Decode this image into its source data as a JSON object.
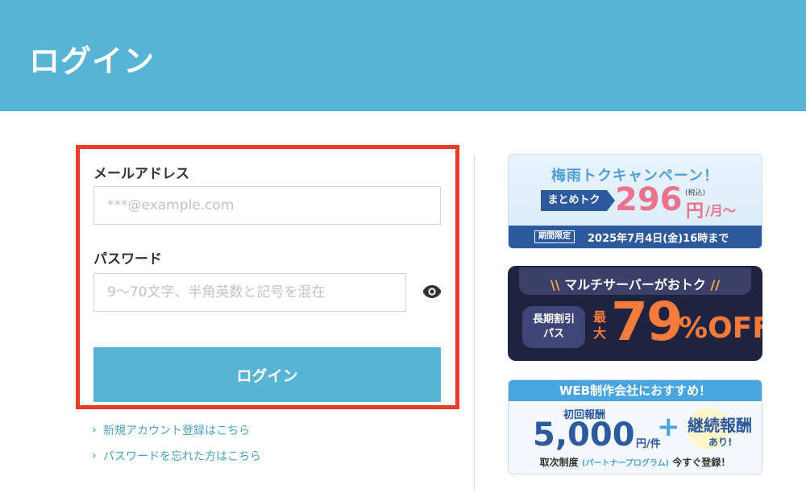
{
  "header": {
    "title": "ログイン"
  },
  "form": {
    "email_label": "メールアドレス",
    "email_placeholder": "***@example.com",
    "email_value": "",
    "password_label": "パスワード",
    "password_placeholder": "9〜70文字、半角英数と記号を混在",
    "password_value": "",
    "toggle_icon": "eye-icon",
    "submit_label": "ログイン"
  },
  "links": {
    "new_account": "新規アカウント登録はこちら",
    "forgot_password": "パスワードを忘れた方はこちら"
  },
  "banners": {
    "rainy": {
      "title": "梅雨トクキャンペーン！",
      "tag": "まとめトク",
      "price": "296",
      "yen": "円",
      "per": "/月〜",
      "tax": "(税込)",
      "limit": "期間限定",
      "date": "2025年7月4日(金)16時まで"
    },
    "multi": {
      "title": "マルチサーバーがおトク",
      "pill_line1": "長期割引",
      "pill_line2": "パス",
      "max": "最大",
      "num": "79",
      "off": "%OFF"
    },
    "web": {
      "head": "WEB制作会社におすすめ！",
      "sub": "初回報酬",
      "num": "5,000",
      "unit": "円/件",
      "plus": "+",
      "continuous": "継続報酬",
      "ari": "あり!",
      "foot_main": "取次制度",
      "foot_paren": "(パートナープログラム)",
      "foot_end": "今すぐ登録！"
    }
  },
  "colors": {
    "header": "#58b4d4",
    "highlight_frame": "#e53e26",
    "link": "#4aa2c3"
  }
}
